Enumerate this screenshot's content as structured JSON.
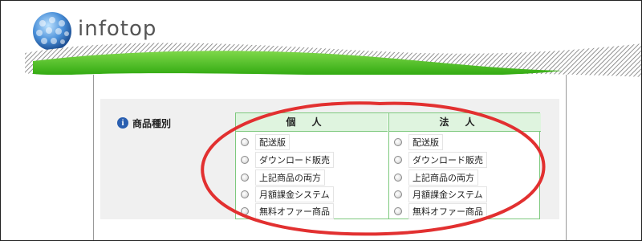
{
  "brand": {
    "name": "infotop"
  },
  "form": {
    "field_label": "商品種別",
    "columns": [
      {
        "heading": "個人",
        "options": [
          "配送版",
          "ダウンロード販売",
          "上記商品の両方",
          "月額課金システム",
          "無料オファー商品"
        ]
      },
      {
        "heading": "法人",
        "options": [
          "配送版",
          "ダウンロード販売",
          "上記商品の両方",
          "月額課金システム",
          "無料オファー商品"
        ]
      }
    ]
  },
  "colors": {
    "accent_green": "#5cc02a",
    "highlight_red": "#e23030",
    "table_border": "#7ec97e"
  },
  "icons": [
    "logo-icon",
    "info-icon",
    "radio-icon"
  ]
}
